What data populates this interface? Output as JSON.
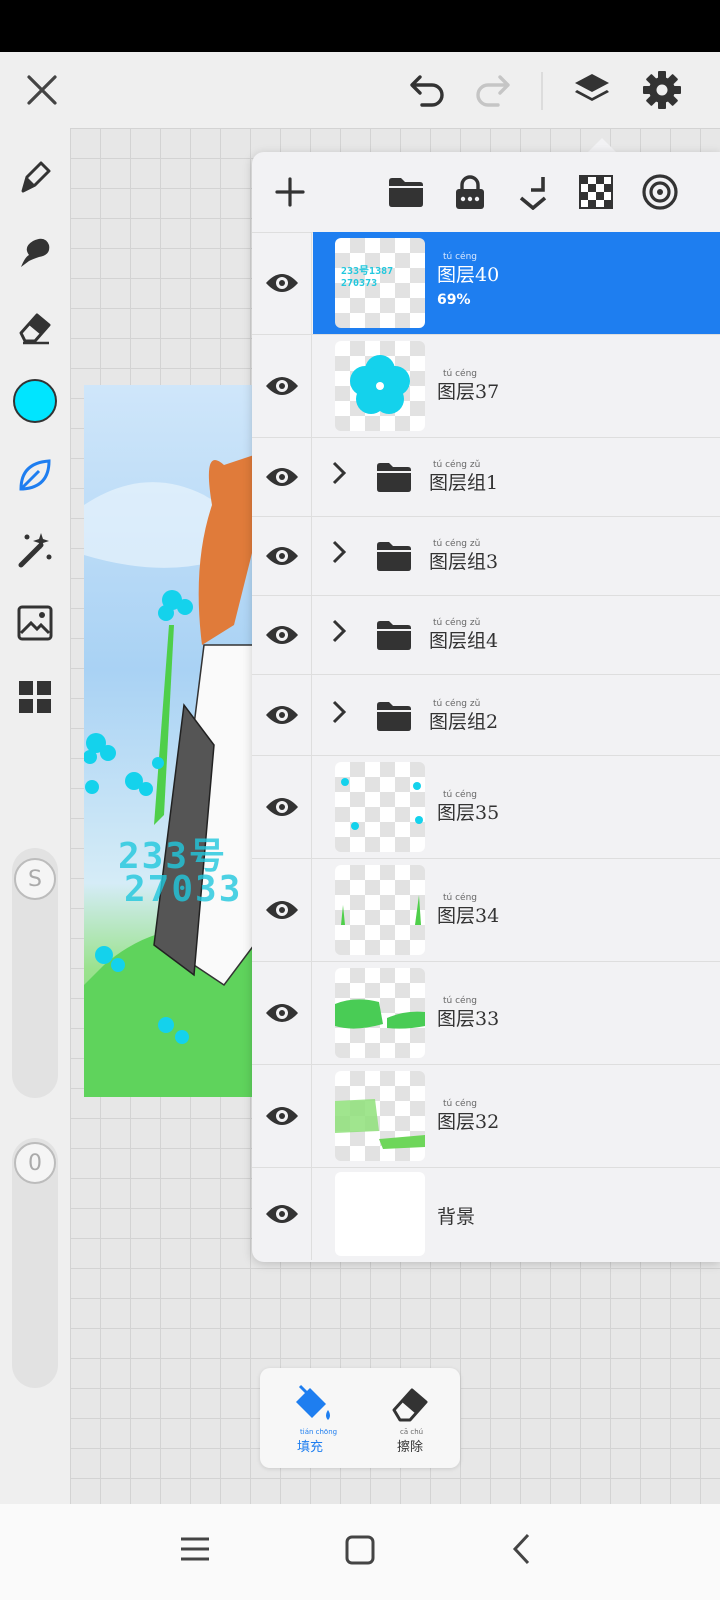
{
  "colors": {
    "accent_blue": "#1e7ef0",
    "current_color": "#00e5ff",
    "layer_selected_bg": "#1e7ef0"
  },
  "topbar": {
    "icons": [
      "close-icon",
      "undo-icon",
      "redo-icon",
      "layers-icon",
      "settings-icon"
    ]
  },
  "left_toolbar": {
    "tools": [
      "brush-icon",
      "smudge-icon",
      "eraser-icon",
      "color-swatch",
      "leaf-brush-icon",
      "magic-wand-icon",
      "image-icon",
      "grid-icon"
    ],
    "size_slider_label": "S",
    "opacity_slider_label": "0"
  },
  "layer_panel": {
    "toolbar_icons": [
      "add-icon",
      "folder-icon",
      "lock-icon",
      "merge-down-icon",
      "transparency-icon",
      "target-icon"
    ],
    "layers": [
      {
        "name": "图层40",
        "ruby": "tú céng",
        "opacity": "69%",
        "selected": true,
        "type": "layer",
        "thumb_text": "233号1387\n270373"
      },
      {
        "name": "图层37",
        "ruby": "tú céng",
        "selected": false,
        "type": "layer"
      },
      {
        "name": "图层组1",
        "ruby": "tú céng zǔ",
        "selected": false,
        "type": "group"
      },
      {
        "name": "图层组3",
        "ruby": "tú céng zǔ",
        "selected": false,
        "type": "group"
      },
      {
        "name": "图层组4",
        "ruby": "tú céng zǔ",
        "selected": false,
        "type": "group"
      },
      {
        "name": "图层组2",
        "ruby": "tú céng zǔ",
        "selected": false,
        "type": "group"
      },
      {
        "name": "图层35",
        "ruby": "tú céng",
        "selected": false,
        "type": "layer"
      },
      {
        "name": "图层34",
        "ruby": "tú céng",
        "selected": false,
        "type": "layer"
      },
      {
        "name": "图层33",
        "ruby": "tú céng",
        "selected": false,
        "type": "layer"
      },
      {
        "name": "图层32",
        "ruby": "tú céng",
        "selected": false,
        "type": "layer"
      },
      {
        "name": "背景",
        "ruby": "",
        "selected": false,
        "type": "background"
      }
    ]
  },
  "fill_panel": {
    "fill_label": "填充",
    "fill_ruby": "tián chōng",
    "erase_label": "擦除",
    "erase_ruby": "cā chú"
  },
  "artwork": {
    "text_line1": "233号",
    "text_line2": "27033"
  },
  "navbar": {
    "icons": [
      "menu-icon",
      "home-icon",
      "back-icon"
    ]
  }
}
